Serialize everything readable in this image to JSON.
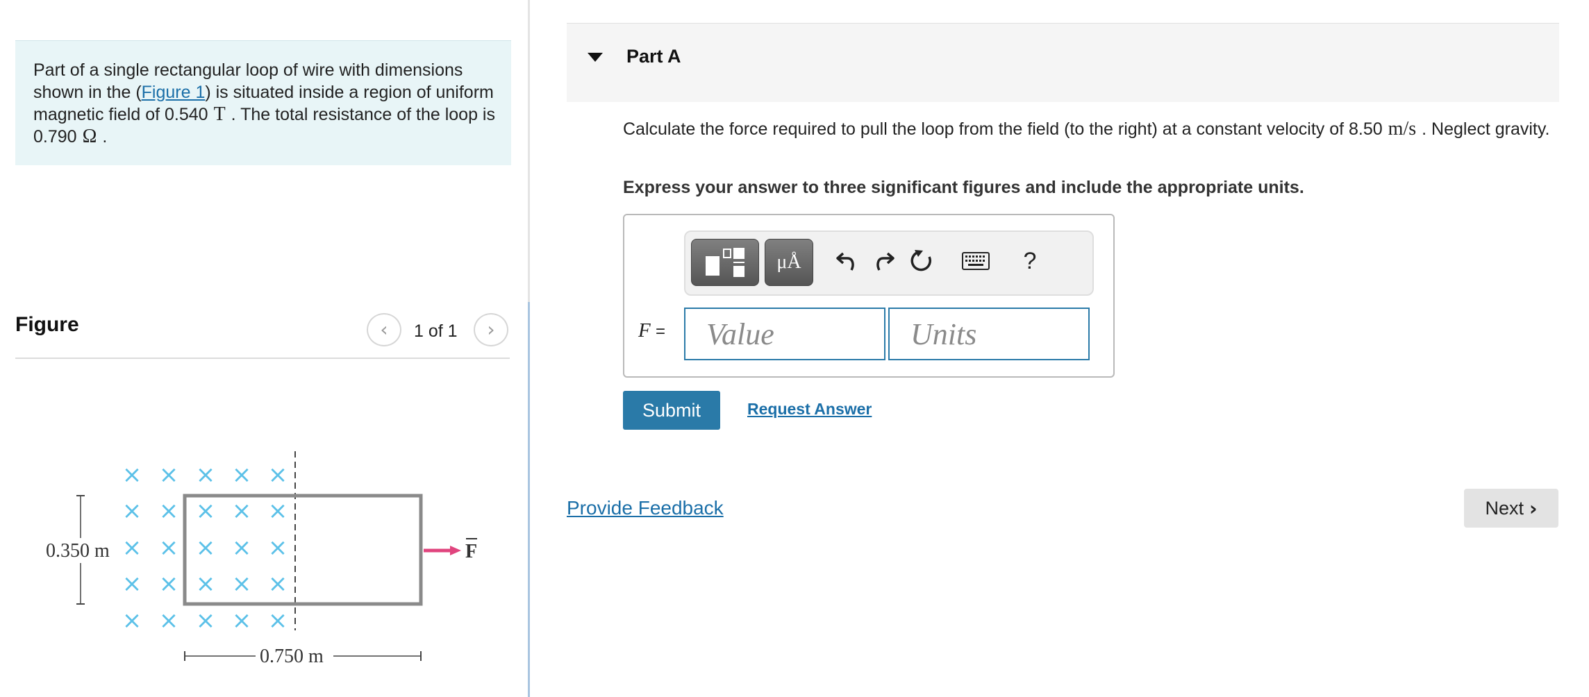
{
  "problem": {
    "text_before_link": "Part of a single rectangular loop of wire with dimensions shown in the (",
    "link_text": "Figure 1",
    "text_after_link": ") is situated inside a region of uniform magnetic field of 0.540",
    "field_unit": "T",
    "text_middle": ". The total resistance of the loop is 0.790",
    "resistance_unit": "Ω",
    "text_end": "."
  },
  "figure": {
    "title": "Figure",
    "prev_icon": "chevron-left-icon",
    "next_icon": "chevron-right-icon",
    "counter": "1 of 1",
    "height_label": "0.350 m",
    "width_label": "0.750 m",
    "force_label": "F",
    "field_symbol": "×",
    "colors": {
      "field": "#5cc1e8",
      "loop": "#8a8a8a",
      "force": "#e0447e"
    }
  },
  "part": {
    "title": "Part A",
    "question_before": "Calculate the force required to pull the loop from the field (to the right) at a constant velocity of 8.50",
    "velocity_unit": "m/s",
    "question_after": ". Neglect gravity.",
    "instruction": "Express your answer to three significant figures and include the appropriate units."
  },
  "toolbar": {
    "template_icon": "template-icon",
    "units_label": "μÅ",
    "undo_icon": "undo-icon",
    "redo_icon": "redo-icon",
    "reset_icon": "reset-icon",
    "keyboard_icon": "keyboard-icon",
    "help_label": "?"
  },
  "answer": {
    "variable": "F",
    "equals": "=",
    "value_placeholder": "Value",
    "units_placeholder": "Units"
  },
  "actions": {
    "submit_label": "Submit",
    "request_label": "Request Answer",
    "feedback_label": "Provide Feedback",
    "next_label": "Next"
  },
  "colors": {
    "accent": "#2a7aa8",
    "link": "#1b6fa8",
    "problem_bg": "#e8f5f7"
  }
}
